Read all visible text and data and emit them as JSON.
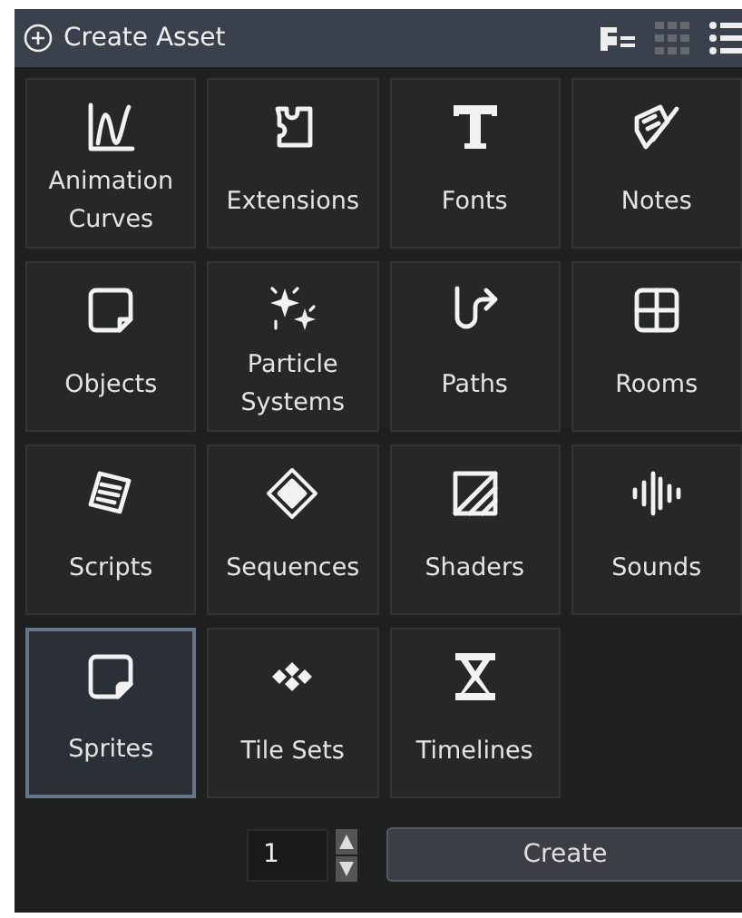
{
  "header": {
    "title": "Create Asset"
  },
  "assets": [
    {
      "label": "Animation Curves",
      "selected": false
    },
    {
      "label": "Extensions",
      "selected": false
    },
    {
      "label": "Fonts",
      "selected": false
    },
    {
      "label": "Notes",
      "selected": false
    },
    {
      "label": "Objects",
      "selected": false
    },
    {
      "label": "Particle Systems",
      "selected": false
    },
    {
      "label": "Paths",
      "selected": false
    },
    {
      "label": "Rooms",
      "selected": false
    },
    {
      "label": "Scripts",
      "selected": false
    },
    {
      "label": "Sequences",
      "selected": false
    },
    {
      "label": "Shaders",
      "selected": false
    },
    {
      "label": "Sounds",
      "selected": false
    },
    {
      "label": "Sprites",
      "selected": true
    },
    {
      "label": "Tile Sets",
      "selected": false
    },
    {
      "label": "Timelines",
      "selected": false
    }
  ],
  "count": {
    "value": "1"
  },
  "create_button": "Create"
}
